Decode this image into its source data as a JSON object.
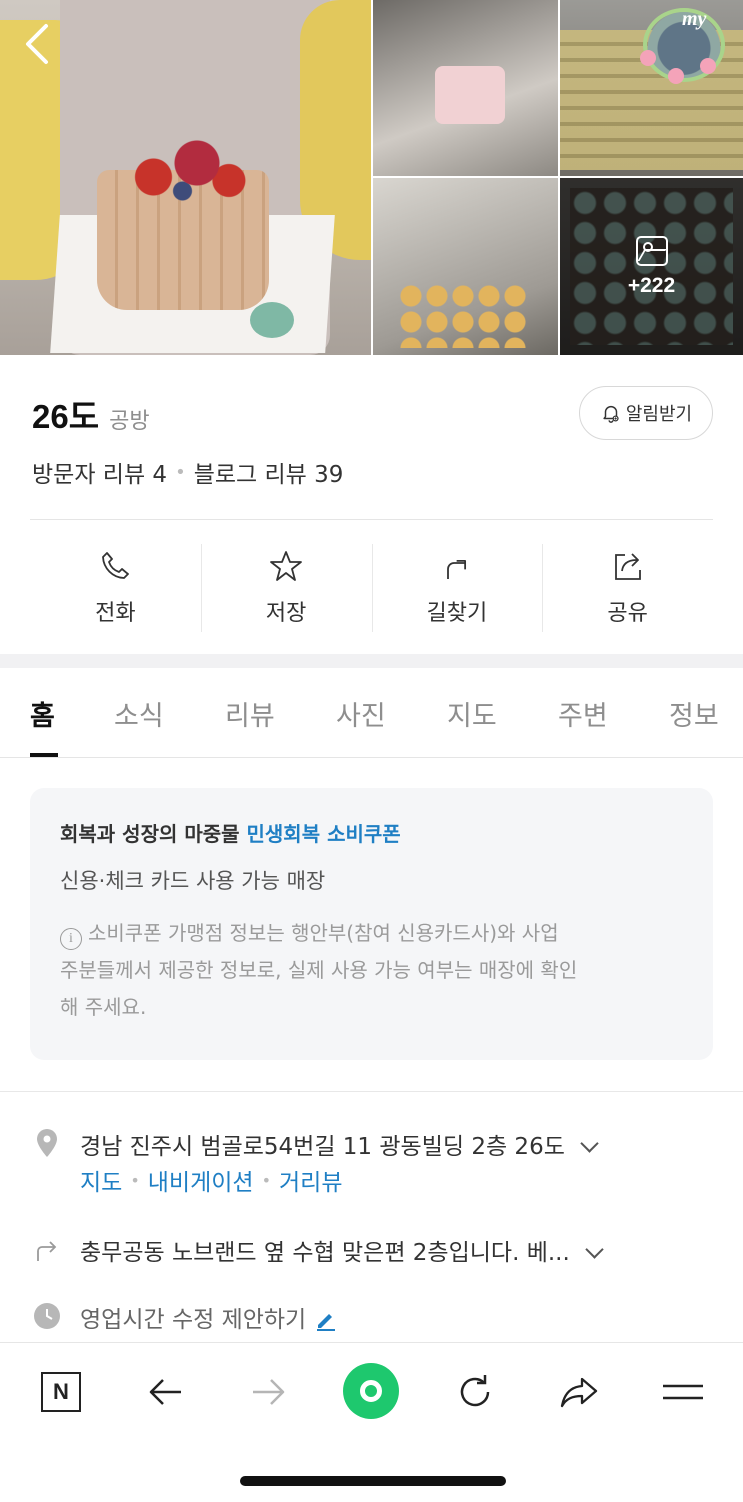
{
  "gallery": {
    "more_count": "+222",
    "badge_text": "my"
  },
  "place": {
    "name": "26도",
    "category": "공방",
    "notify_label": "알림받기",
    "visitor_reviews": "방문자 리뷰 4",
    "blog_reviews": "블로그 리뷰 39"
  },
  "actions": [
    {
      "label": "전화",
      "icon": "phone-icon"
    },
    {
      "label": "저장",
      "icon": "star-icon"
    },
    {
      "label": "길찾기",
      "icon": "directions-icon"
    },
    {
      "label": "공유",
      "icon": "share-icon"
    }
  ],
  "tabs": [
    "홈",
    "소식",
    "리뷰",
    "사진",
    "지도",
    "주변",
    "정보"
  ],
  "active_tab": "홈",
  "coupon": {
    "title_prefix": "회복과 성장의 마중물",
    "title_highlight": "민생회복 소비쿠폰",
    "subtitle": "신용·체크 카드 사용 가능 매장",
    "note_lines": [
      "소비쿠폰 가맹점 정보는 행안부(참여 신용카드사)와 사업",
      "주분들께서 제공한 정보로, 실제 사용 가능 여부는 매장에 확인",
      "해 주세요."
    ]
  },
  "info": {
    "address": "경남 진주시 범골로54번길 11 광동빌딩 2층 26도",
    "links": [
      "지도",
      "내비게이션",
      "거리뷰"
    ],
    "directions_text": "충무공동 노브랜드 옆 수협 맞은편 2층입니다. 베...",
    "hours_suggest": "영업시간 수정 제안하기"
  },
  "bottom_bar": {
    "n_label": "N"
  },
  "colors": {
    "accent_blue": "#1f7fc4",
    "green": "#1ec86e"
  }
}
